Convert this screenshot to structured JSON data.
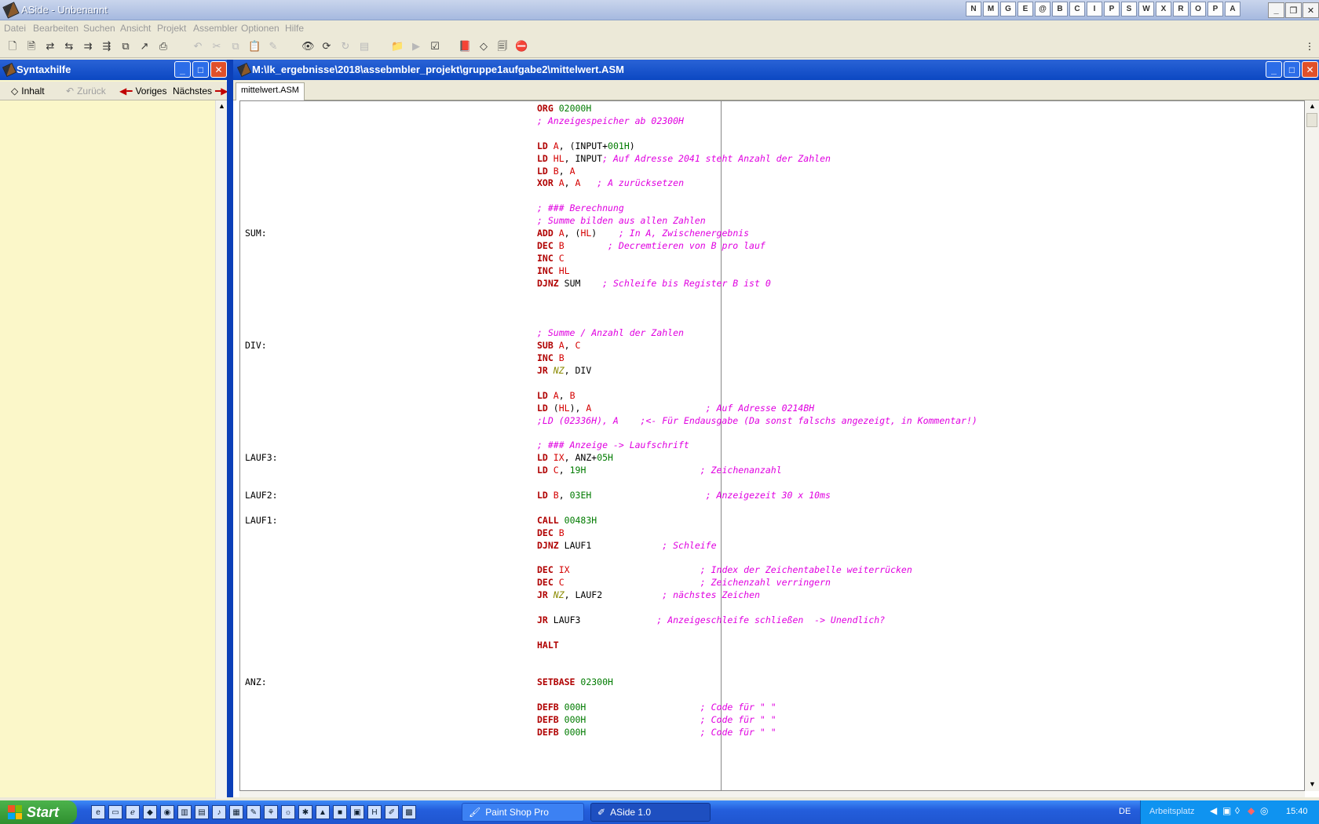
{
  "window": {
    "title": "ASide - Unbenannt",
    "quick_icons": [
      "N",
      "M",
      "G",
      "E",
      "@",
      "B",
      "C",
      "I",
      "P",
      "S",
      "W",
      "X",
      "R",
      "O",
      "P",
      "A"
    ]
  },
  "menu": [
    "Datei",
    "Bearbeiten",
    "Suchen",
    "Ansicht",
    "Projekt",
    "Assembler",
    "Optionen",
    "Hilfe"
  ],
  "help_panel": {
    "title": "Syntaxhilfe",
    "btn_inhalt": "Inhalt",
    "btn_zurueck": "Zurück",
    "btn_voriges": "Voriges",
    "btn_naechstes": "Nächstes"
  },
  "editor": {
    "title": "M:\\lk_ergebnisse\\2018\\assebmbler_projekt\\gruppe1aufgabe2\\mittelwert.ASM",
    "tab": "mittelwert.ASM"
  },
  "code": [
    {
      "label": "",
      "instr": "ORG",
      "args": [
        {
          "t": "02000H",
          "c": "num"
        }
      ],
      "comment": ""
    },
    {
      "label": "",
      "instr": "",
      "args": [],
      "comment": "; Anzeigespeicher ab 02300H"
    },
    {
      "label": "",
      "instr": "",
      "args": [],
      "comment": ""
    },
    {
      "label": "",
      "instr": "LD",
      "args": [
        {
          "t": "A",
          "c": "reg"
        },
        {
          "t": ", (INPUT+",
          "c": "txt"
        },
        {
          "t": "001H",
          "c": "num"
        },
        {
          "t": ")",
          "c": "txt"
        }
      ],
      "comment": ""
    },
    {
      "label": "",
      "instr": "LD",
      "args": [
        {
          "t": "HL",
          "c": "reg"
        },
        {
          "t": ", INPUT",
          "c": "txt"
        }
      ],
      "comment": "; Auf Adresse 2041 steht Anzahl der Zahlen"
    },
    {
      "label": "",
      "instr": "LD",
      "args": [
        {
          "t": "B",
          "c": "reg"
        },
        {
          "t": ", ",
          "c": "txt"
        },
        {
          "t": "A",
          "c": "reg"
        }
      ],
      "comment": ""
    },
    {
      "label": "",
      "instr": "XOR",
      "args": [
        {
          "t": "A",
          "c": "reg"
        },
        {
          "t": ", ",
          "c": "txt"
        },
        {
          "t": "A",
          "c": "reg"
        }
      ],
      "comment": "   ; A zurücksetzen"
    },
    {
      "label": "",
      "instr": "",
      "args": [],
      "comment": ""
    },
    {
      "label": "",
      "instr": "",
      "args": [],
      "comment": "; ### Berechnung"
    },
    {
      "label": "",
      "instr": "",
      "args": [],
      "comment": "; Summe bilden aus allen Zahlen"
    },
    {
      "label": "SUM:",
      "instr": "ADD",
      "args": [
        {
          "t": "A",
          "c": "reg"
        },
        {
          "t": ", (",
          "c": "txt"
        },
        {
          "t": "HL",
          "c": "reg"
        },
        {
          "t": ")",
          "c": "txt"
        }
      ],
      "comment": "    ; In A, Zwischenergebnis"
    },
    {
      "label": "",
      "instr": "DEC",
      "args": [
        {
          "t": "B",
          "c": "reg"
        }
      ],
      "comment": "        ; Decremtieren von B pro lauf"
    },
    {
      "label": "",
      "instr": "INC",
      "args": [
        {
          "t": "C",
          "c": "reg"
        }
      ],
      "comment": ""
    },
    {
      "label": "",
      "instr": "INC",
      "args": [
        {
          "t": "HL",
          "c": "reg"
        }
      ],
      "comment": ""
    },
    {
      "label": "",
      "instr": "DJNZ",
      "args": [
        {
          "t": "SUM",
          "c": "txt"
        }
      ],
      "comment": "    ; Schleife bis Register B ist 0"
    },
    {
      "label": "",
      "instr": "",
      "args": [],
      "comment": ""
    },
    {
      "label": "",
      "instr": "",
      "args": [],
      "comment": ""
    },
    {
      "label": "",
      "instr": "",
      "args": [],
      "comment": ""
    },
    {
      "label": "",
      "instr": "",
      "args": [],
      "comment": "; Summe / Anzahl der Zahlen"
    },
    {
      "label": "DIV:",
      "instr": "SUB",
      "args": [
        {
          "t": "A",
          "c": "reg"
        },
        {
          "t": ", ",
          "c": "txt"
        },
        {
          "t": "C",
          "c": "reg"
        }
      ],
      "comment": ""
    },
    {
      "label": "",
      "instr": "INC",
      "args": [
        {
          "t": "B",
          "c": "reg"
        }
      ],
      "comment": ""
    },
    {
      "label": "",
      "instr": "JR",
      "args": [
        {
          "t": "NZ",
          "c": "cond"
        },
        {
          "t": ", DIV",
          "c": "txt"
        }
      ],
      "comment": ""
    },
    {
      "label": "",
      "instr": "",
      "args": [],
      "comment": ""
    },
    {
      "label": "",
      "instr": "LD",
      "args": [
        {
          "t": "A",
          "c": "reg"
        },
        {
          "t": ", ",
          "c": "txt"
        },
        {
          "t": "B",
          "c": "reg"
        }
      ],
      "comment": ""
    },
    {
      "label": "",
      "instr": "LD",
      "args": [
        {
          "t": "(",
          "c": "txt"
        },
        {
          "t": "HL",
          "c": "reg"
        },
        {
          "t": "), ",
          "c": "txt"
        },
        {
          "t": "A",
          "c": "reg"
        }
      ],
      "comment": "                     ; Auf Adresse 0214BH"
    },
    {
      "label": "",
      "instr": "",
      "args": [],
      "comment": ";LD (02336H), A    ;<- Für Endausgabe (Da sonst falschs angezeigt, in Kommentar!)"
    },
    {
      "label": "",
      "instr": "",
      "args": [],
      "comment": ""
    },
    {
      "label": "",
      "instr": "",
      "args": [],
      "comment": "; ### Anzeige -> Laufschrift"
    },
    {
      "label": "LAUF3:",
      "instr": "LD",
      "args": [
        {
          "t": "IX",
          "c": "reg"
        },
        {
          "t": ", ANZ+",
          "c": "txt"
        },
        {
          "t": "05H",
          "c": "num"
        }
      ],
      "comment": ""
    },
    {
      "label": "",
      "instr": "LD",
      "args": [
        {
          "t": "C",
          "c": "reg"
        },
        {
          "t": ", ",
          "c": "txt"
        },
        {
          "t": "19H",
          "c": "num"
        }
      ],
      "comment": "                     ; Zeichenanzahl"
    },
    {
      "label": "",
      "instr": "",
      "args": [],
      "comment": ""
    },
    {
      "label": "LAUF2:",
      "instr": "LD",
      "args": [
        {
          "t": "B",
          "c": "reg"
        },
        {
          "t": ", ",
          "c": "txt"
        },
        {
          "t": "03EH",
          "c": "num"
        }
      ],
      "comment": "                     ; Anzeigezeit 30 x 10ms"
    },
    {
      "label": "",
      "instr": "",
      "args": [],
      "comment": ""
    },
    {
      "label": "LAUF1:",
      "instr": "CALL",
      "args": [
        {
          "t": "00483H",
          "c": "num"
        }
      ],
      "comment": ""
    },
    {
      "label": "",
      "instr": "DEC",
      "args": [
        {
          "t": "B",
          "c": "reg"
        }
      ],
      "comment": ""
    },
    {
      "label": "",
      "instr": "DJNZ",
      "args": [
        {
          "t": "LAUF1",
          "c": "txt"
        }
      ],
      "comment": "             ; Schleife"
    },
    {
      "label": "",
      "instr": "",
      "args": [],
      "comment": ""
    },
    {
      "label": "",
      "instr": "DEC",
      "args": [
        {
          "t": "IX",
          "c": "reg"
        }
      ],
      "comment": "                        ; Index der Zeichentabelle weiterrücken"
    },
    {
      "label": "",
      "instr": "DEC",
      "args": [
        {
          "t": "C",
          "c": "reg"
        }
      ],
      "comment": "                         ; Zeichenzahl verringern"
    },
    {
      "label": "",
      "instr": "JR",
      "args": [
        {
          "t": "NZ",
          "c": "cond"
        },
        {
          "t": ", LAUF2",
          "c": "txt"
        }
      ],
      "comment": "           ; nächstes Zeichen"
    },
    {
      "label": "",
      "instr": "",
      "args": [],
      "comment": ""
    },
    {
      "label": "",
      "instr": "JR",
      "args": [
        {
          "t": "LAUF3",
          "c": "txt"
        }
      ],
      "comment": "              ; Anzeigeschleife schließen  -> Unendlich?"
    },
    {
      "label": "",
      "instr": "",
      "args": [],
      "comment": ""
    },
    {
      "label": "",
      "instr": "HALT",
      "args": [],
      "comment": ""
    },
    {
      "label": "",
      "instr": "",
      "args": [],
      "comment": ""
    },
    {
      "label": "",
      "instr": "",
      "args": [],
      "comment": ""
    },
    {
      "label": "ANZ:",
      "instr": "SETBASE",
      "args": [
        {
          "t": "02300H",
          "c": "num"
        }
      ],
      "comment": ""
    },
    {
      "label": "",
      "instr": "",
      "args": [],
      "comment": ""
    },
    {
      "label": "",
      "instr": "DEFB",
      "args": [
        {
          "t": "000H",
          "c": "num"
        }
      ],
      "comment": "                     ; Code für \" \""
    },
    {
      "label": "",
      "instr": "DEFB",
      "args": [
        {
          "t": "000H",
          "c": "num"
        }
      ],
      "comment": "                     ; Code für \" \""
    },
    {
      "label": "",
      "instr": "DEFB",
      "args": [
        {
          "t": "000H",
          "c": "num"
        }
      ],
      "comment": "                     ; Code für \" \""
    }
  ],
  "taskbar": {
    "start": "Start",
    "task1": "Paint Shop Pro",
    "task2": "ASide 1.0",
    "lang": "DE",
    "arbeitsplatz": "Arbeitsplatz",
    "clock": "15:40"
  }
}
